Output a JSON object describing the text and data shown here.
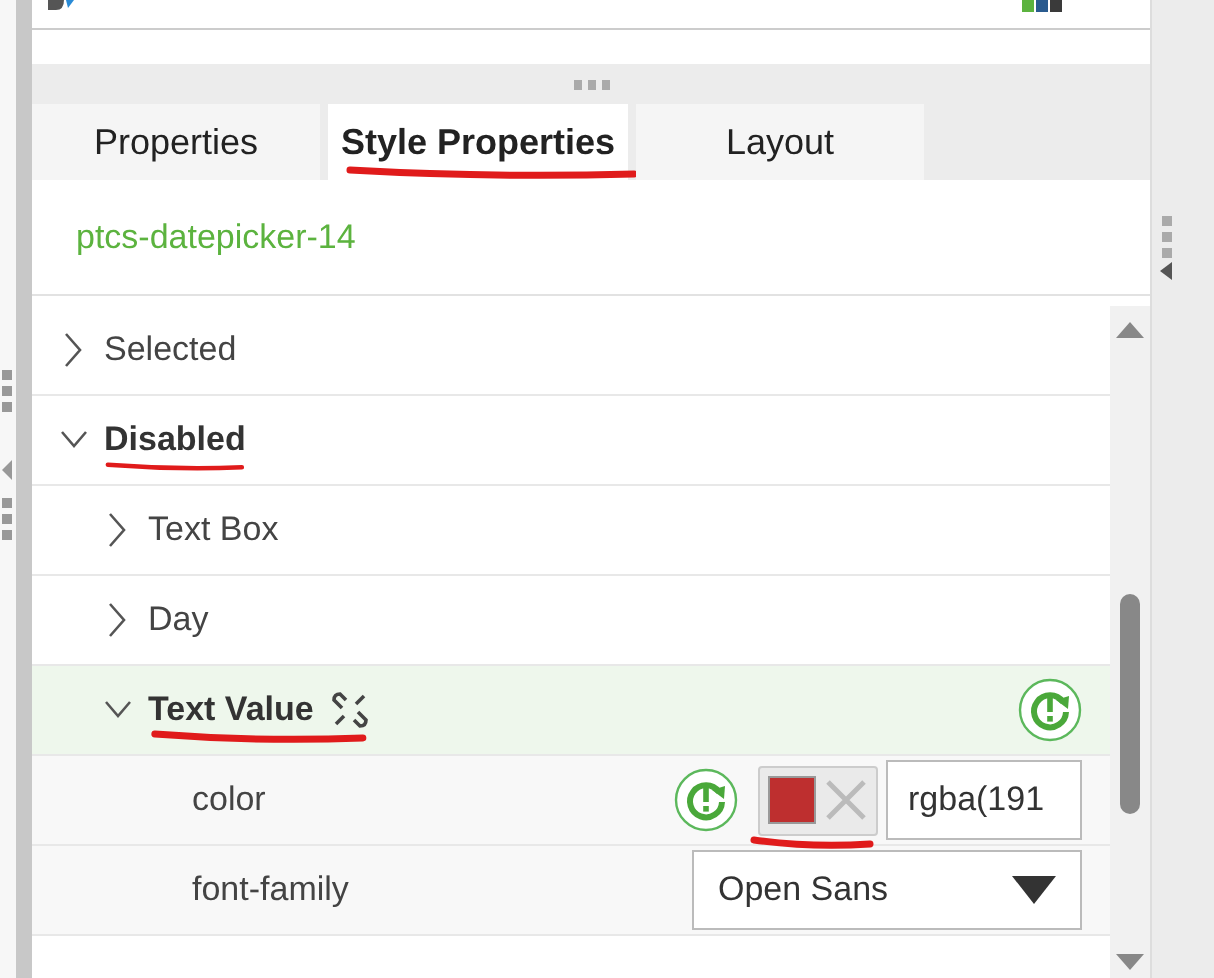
{
  "tabs": [
    {
      "label": "Properties",
      "selected": false,
      "annotated": false
    },
    {
      "label": "Style Properties",
      "selected": true,
      "annotated": true
    },
    {
      "label": "Layout",
      "selected": false,
      "annotated": false
    }
  ],
  "component_name": "ptcs-datepicker-14",
  "style_tree": [
    {
      "label": "Selected",
      "expanded": false,
      "annotated": false
    },
    {
      "label": "Disabled",
      "expanded": true,
      "annotated": true,
      "children": [
        {
          "label": "Text Box",
          "expanded": false,
          "annotated": false
        },
        {
          "label": "Day",
          "expanded": false,
          "annotated": false
        },
        {
          "label": "Text Value",
          "expanded": true,
          "annotated": true,
          "highlighted": true,
          "unlinked": true,
          "reset": true,
          "properties": [
            {
              "kind": "color",
              "name": "color",
              "reset": true,
              "color": "#be2f2f",
              "value": "rgba(191",
              "annotated": true
            },
            {
              "kind": "select",
              "name": "font-family",
              "reset": false,
              "value": "Open Sans",
              "annotated": false
            }
          ]
        }
      ]
    }
  ]
}
